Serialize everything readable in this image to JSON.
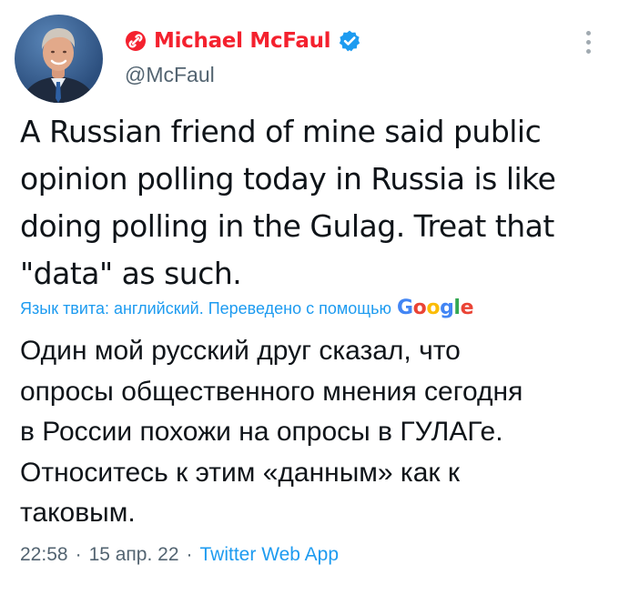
{
  "colors": {
    "name": "#f4212e",
    "link": "#1d9bf0",
    "muted": "#536471",
    "text": "#0f1419",
    "verified": "#1d9bf0"
  },
  "author": {
    "name": "Michael McFaul",
    "handle": "@McFaul",
    "name_icon": "link-circle-icon",
    "verified_icon": "verified-badge-icon"
  },
  "tweet": {
    "text": "A Russian friend of mine said public\nopinion polling today in Russia is like\ndoing polling in the Gulag.  Treat that\n\"data\"  as such."
  },
  "translation": {
    "label": "Язык твита: английский. Переведено с помощью",
    "provider": [
      "G",
      "o",
      "o",
      "g",
      "l",
      "e"
    ],
    "text": "Один мой русский друг сказал, что\nопросы общественного мнения сегодня\nв России похожи на опросы в ГУЛАГе.\nОтноситесь к этим «данным» как к\nтаковым."
  },
  "meta": {
    "time": "22:58",
    "sep1": "·",
    "date": "15 апр. 22",
    "sep2": "·",
    "source": "Twitter Web App"
  }
}
